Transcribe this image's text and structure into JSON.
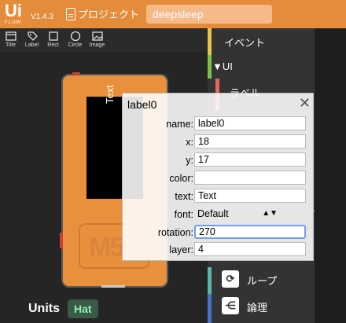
{
  "app": {
    "logo": "Ui",
    "logo_sub": "FLOW",
    "version": "V1.4.3",
    "project_label": "プロジェクト",
    "project_name": "deepsleep"
  },
  "toolbar": [
    {
      "label": "Title",
      "icon": "title-icon"
    },
    {
      "label": "Label",
      "icon": "label-icon"
    },
    {
      "label": "Rect",
      "icon": "rect-icon"
    },
    {
      "label": "Circle",
      "icon": "circle-icon"
    },
    {
      "label": "Image",
      "icon": "image-icon"
    }
  ],
  "device": {
    "screen_text": "Text"
  },
  "units": {
    "label": "Units",
    "badge": "Hat"
  },
  "blocks": {
    "event": "イベント",
    "ui": "▼UI",
    "label": "ラベル",
    "loop": "ループ",
    "logic": "論理",
    "colors": {
      "event": "#e8c64a",
      "ui": "#7cc24a",
      "label": "#e46a5a",
      "loop": "#5bb5a8",
      "logic": "#4a6fd0"
    }
  },
  "properties": {
    "title": "label0",
    "close": "✕",
    "fields": [
      {
        "key": "name:",
        "value": "label0"
      },
      {
        "key": "x:",
        "value": "18"
      },
      {
        "key": "y:",
        "value": "17"
      },
      {
        "key": "color:",
        "value": ""
      },
      {
        "key": "text:",
        "value": "Text"
      },
      {
        "key": "font:",
        "value": "Default"
      },
      {
        "key": "rotation:",
        "value": "270"
      },
      {
        "key": "layer:",
        "value": "4"
      }
    ]
  }
}
